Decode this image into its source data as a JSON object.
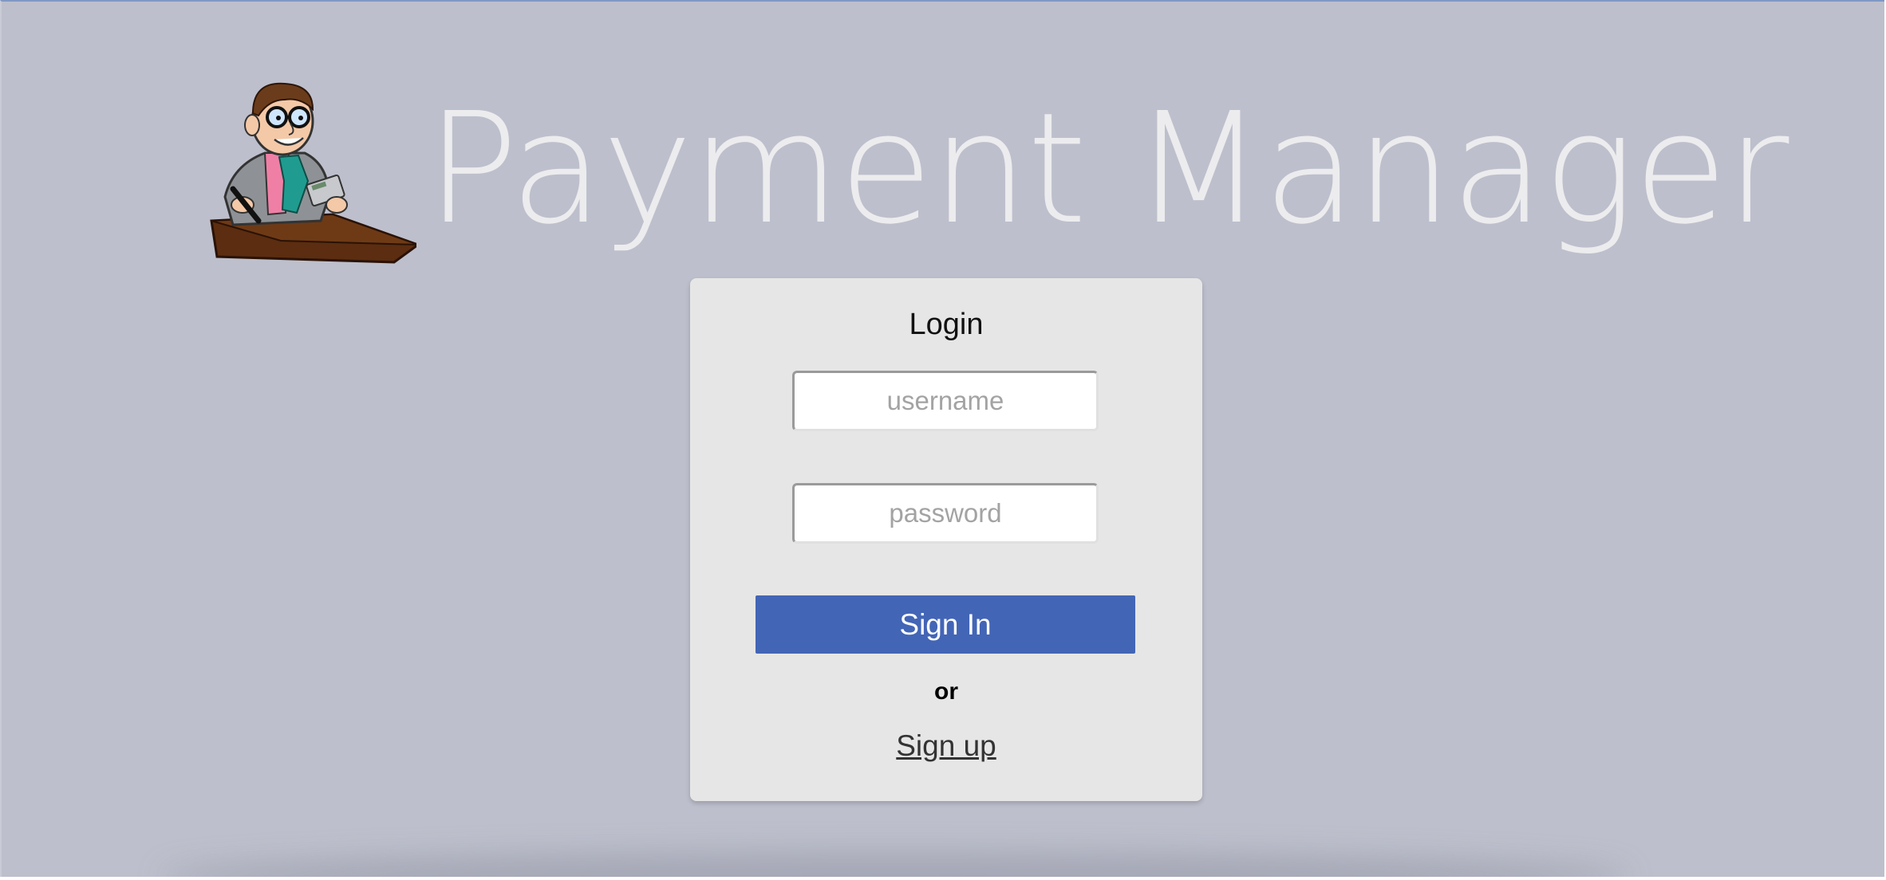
{
  "header": {
    "title": "Payment Manager",
    "logo_icon": "accountant-mascot-icon"
  },
  "login": {
    "title": "Login",
    "username_placeholder": "username",
    "username_value": "",
    "password_placeholder": "password",
    "password_value": "",
    "signin_label": "Sign In",
    "or_label": "or",
    "signup_label": "Sign up"
  },
  "colors": {
    "background": "#bdbfcc",
    "card": "#e6e6e6",
    "accent": "#4365b6",
    "title_text": "#ececee"
  }
}
